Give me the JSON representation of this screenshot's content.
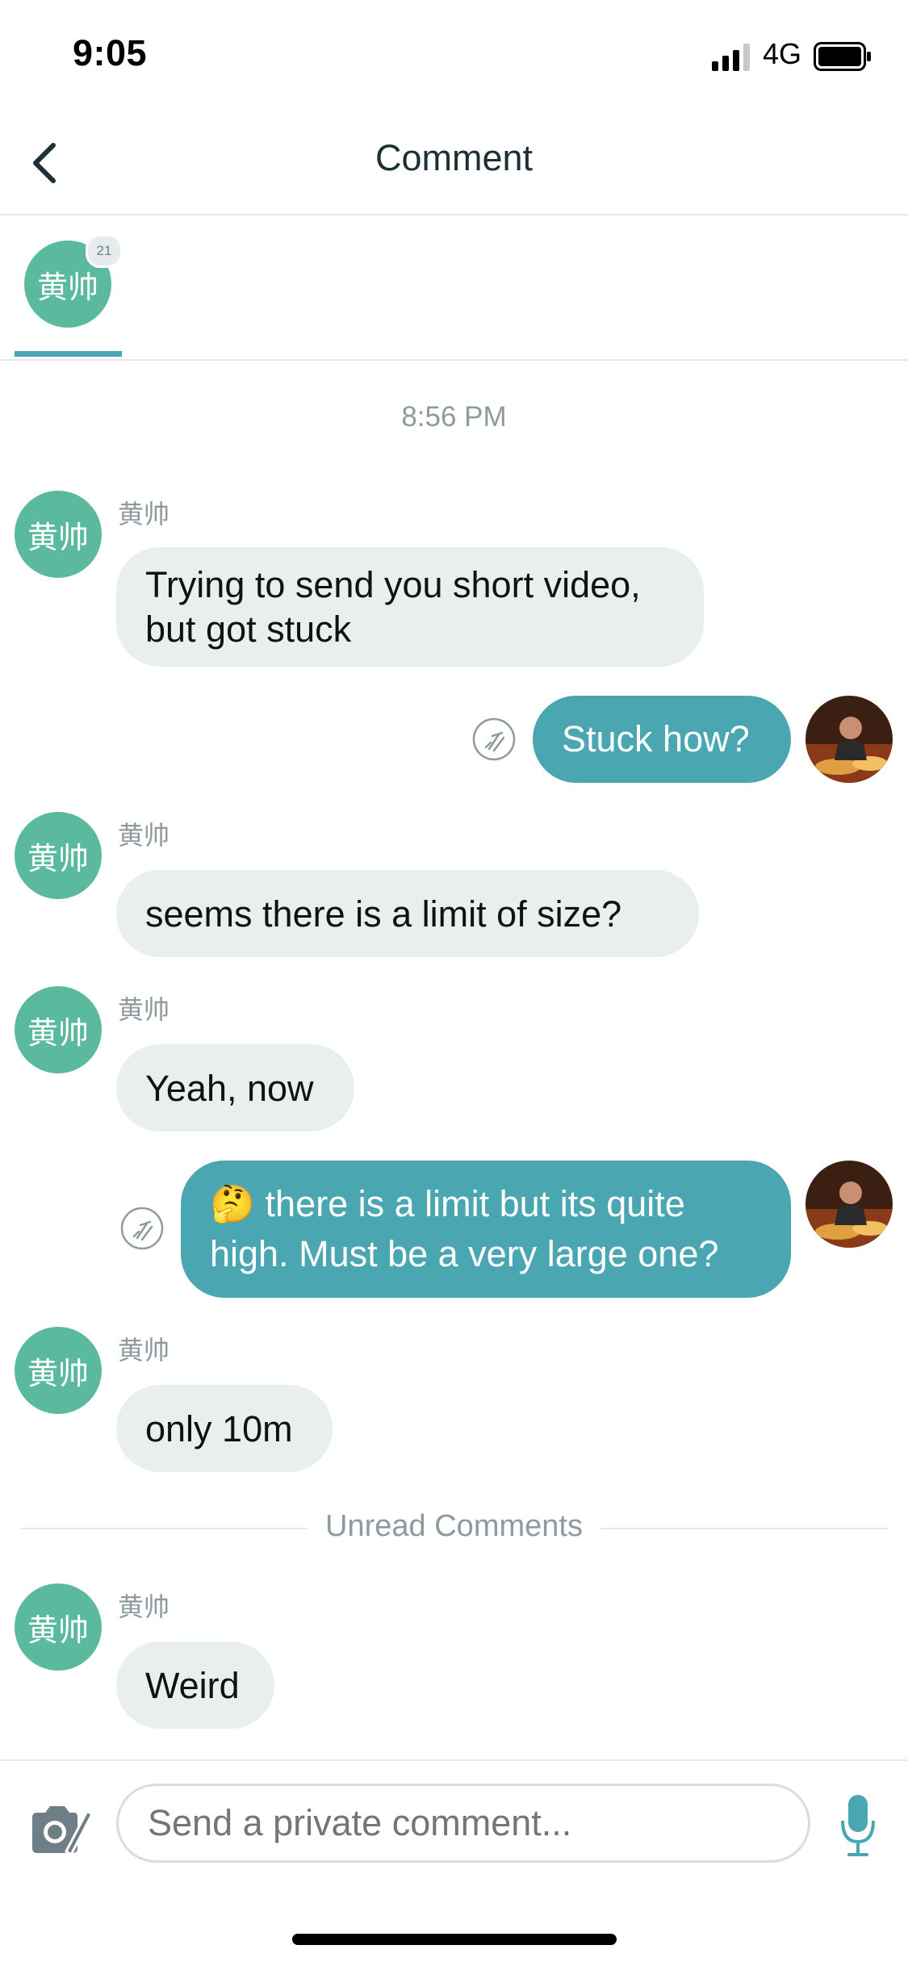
{
  "status": {
    "time": "9:05",
    "network": "4G"
  },
  "header": {
    "title": "Comment"
  },
  "strip": {
    "avatar_text": "黄帅",
    "badge_count": "21"
  },
  "timestamp": "8:56 PM",
  "messages": [
    {
      "sender": "黄帅",
      "avatar": "黄帅",
      "lines": [
        "Trying to send you short video,",
        "but got stuck"
      ]
    },
    {
      "text": "Stuck how?"
    },
    {
      "sender": "黄帅",
      "avatar": "黄帅",
      "text": "seems there is a limit of size?"
    },
    {
      "sender": "黄帅",
      "avatar": "黄帅",
      "text": "Yeah, now"
    },
    {
      "emoji": "🤔",
      "lines": [
        "there is a limit but its quite",
        "high.  Must be a very large one?"
      ]
    },
    {
      "sender": "黄帅",
      "avatar": "黄帅",
      "text": "only 10m"
    },
    {
      "sender": "黄帅",
      "avatar": "黄帅",
      "text": "Weird"
    }
  ],
  "unread_label": "Unread Comments",
  "composer": {
    "placeholder": "Send a private comment..."
  },
  "icons": {
    "back": "chevron-left-icon",
    "camera": "camera-edit-icon",
    "mic": "microphone-icon",
    "read": "seen-receipt-icon",
    "signal": "cellular-signal-icon",
    "battery": "battery-icon"
  },
  "colors": {
    "accent": "#4aa6b0",
    "avatar": "#5bb99e",
    "incoming_bubble": "#e9eeee",
    "muted_text": "#8d9aa0"
  }
}
